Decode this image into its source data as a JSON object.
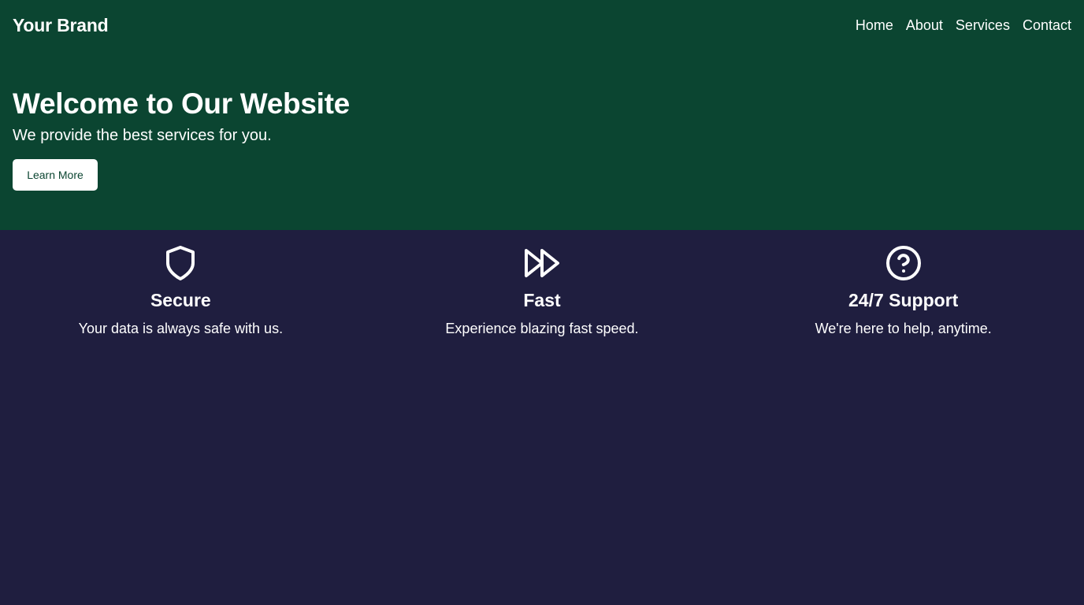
{
  "brand": "Your Brand",
  "nav": {
    "items": [
      {
        "label": "Home"
      },
      {
        "label": "About"
      },
      {
        "label": "Services"
      },
      {
        "label": "Contact"
      }
    ]
  },
  "hero": {
    "title": "Welcome to Our Website",
    "subtitle": "We provide the best services for you.",
    "cta_label": "Learn More"
  },
  "features": [
    {
      "icon": "shield-icon",
      "title": "Secure",
      "description": "Your data is always safe with us."
    },
    {
      "icon": "fast-forward-icon",
      "title": "Fast",
      "description": "Experience blazing fast speed."
    },
    {
      "icon": "help-circle-icon",
      "title": "24/7 Support",
      "description": "We're here to help, anytime."
    }
  ],
  "colors": {
    "hero_background": "#0b4531",
    "page_background": "#1f1e3f",
    "text": "#ffffff",
    "button_background": "#ffffff",
    "button_text": "#0b4531"
  }
}
